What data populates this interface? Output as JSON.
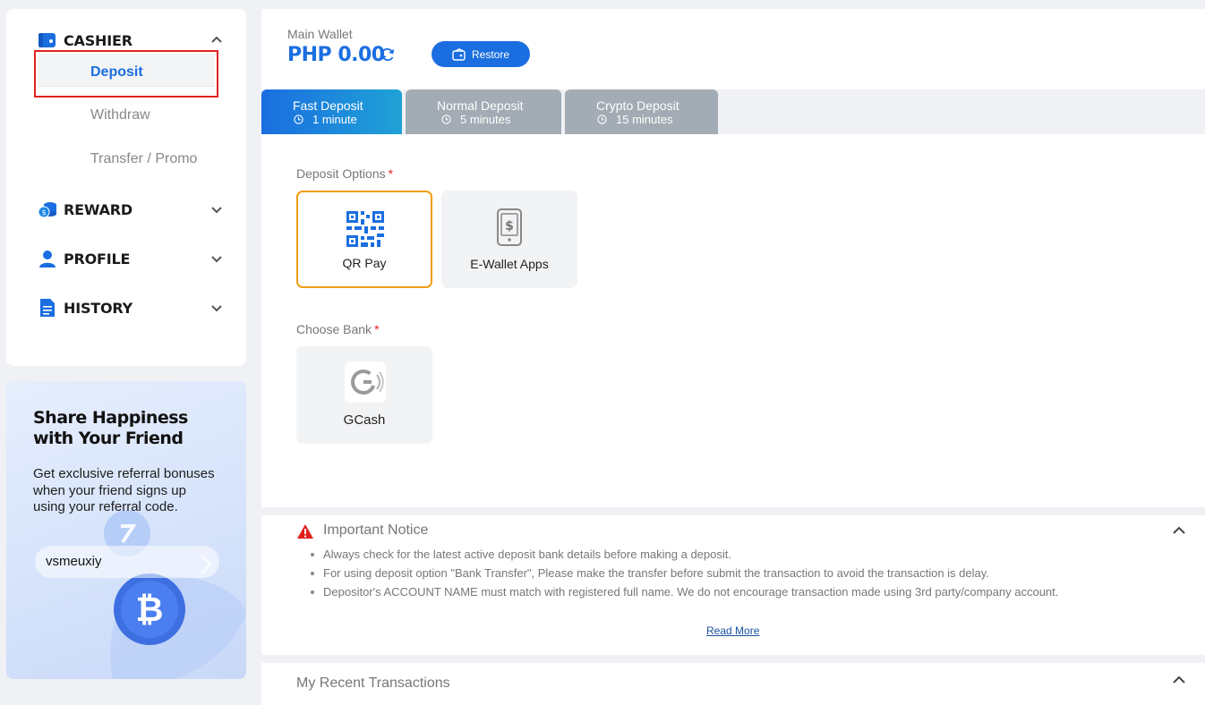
{
  "sidebar": {
    "cashier": {
      "label": "CASHIER",
      "icon": "wallet-icon"
    },
    "cashier_items": [
      {
        "label": "Deposit",
        "active": true
      },
      {
        "label": "Withdraw",
        "active": false
      },
      {
        "label": "Transfer / Promo",
        "active": false
      }
    ],
    "reward": {
      "label": "REWARD",
      "icon": "coins-icon"
    },
    "profile": {
      "label": "PROFILE",
      "icon": "user-icon"
    },
    "history": {
      "label": "HISTORY",
      "icon": "document-icon"
    }
  },
  "promo": {
    "title": "Share Happiness with Your Friend",
    "description": "Get exclusive referral bonuses when your friend signs up using your referral code.",
    "referral_code": "vsmeuxiy"
  },
  "wallet": {
    "label": "Main Wallet",
    "amount": "PHP 0.00",
    "restore_label": "Restore"
  },
  "tabs": [
    {
      "title": "Fast Deposit",
      "time": "1 minute",
      "active": true
    },
    {
      "title": "Normal Deposit",
      "time": "5 minutes",
      "active": false
    },
    {
      "title": "Crypto Deposit",
      "time": "15 minutes",
      "active": false
    }
  ],
  "deposit": {
    "options_label": "Deposit Options",
    "required_mark": "*",
    "options": [
      {
        "label": "QR Pay",
        "icon": "qr-code-icon",
        "selected": true
      },
      {
        "label": "E-Wallet Apps",
        "icon": "mobile-wallet-icon",
        "selected": false
      }
    ],
    "bank_label": "Choose Bank",
    "banks": [
      {
        "label": "GCash",
        "icon": "gcash-logo-icon"
      }
    ]
  },
  "notice": {
    "title": "Important Notice",
    "items": [
      "Always check for the latest active deposit bank details before making a deposit.",
      "For using deposit option \"Bank Transfer\", Please make the transfer before submit the transaction to avoid the transaction is delay.",
      "Depositor's ACCOUNT NAME must match with registered full name. We do not encourage transaction made using 3rd party/company account."
    ],
    "read_more": "Read More"
  },
  "recent": {
    "title": "My Recent Transactions"
  },
  "colors": {
    "accent": "#1a6ee0",
    "selected_border": "#f39c12",
    "highlight_box": "#e0211e",
    "inactive_tab": "#a3acb4"
  }
}
